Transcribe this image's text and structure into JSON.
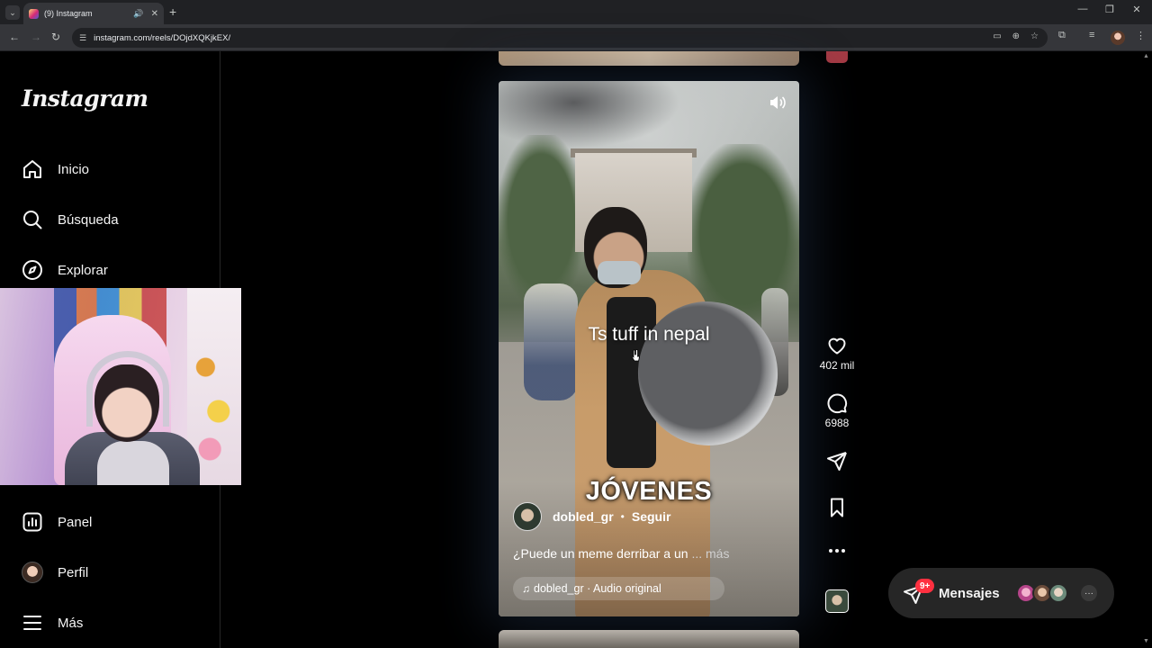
{
  "browser": {
    "tab_title": "(9) Instagram",
    "url": "instagram.com/reels/DOjdXQKjkEX/",
    "new_tab": "+",
    "win_min": "—",
    "win_restore": "❐",
    "win_close": "✕"
  },
  "sidebar": {
    "logo": "Instagram",
    "items": [
      {
        "label": "Inicio",
        "icon": "home-icon"
      },
      {
        "label": "Búsqueda",
        "icon": "search-icon"
      },
      {
        "label": "Explorar",
        "icon": "compass-icon"
      },
      {
        "label": "Panel",
        "icon": "dashboard-icon"
      },
      {
        "label": "Perfil",
        "icon": "avatar"
      },
      {
        "label": "Más",
        "icon": "menu-icon"
      }
    ]
  },
  "reel": {
    "overlay_text": "Ts tuff in nepal",
    "caption_big": "JÓVENES",
    "author": "dobled_gr",
    "separator": "•",
    "follow": "Seguir",
    "description": "¿Puede un meme derribar a un",
    "more": "... más",
    "audio": "dobled_gr · Audio original"
  },
  "actions": {
    "likes": "402 mil",
    "comments": "6988"
  },
  "messages": {
    "label": "Mensajes",
    "badge": "9+",
    "more": "···"
  },
  "colors": {
    "background": "#000000",
    "badge": "#ff3040",
    "chrome_dark": "#202124",
    "chrome_toolbar": "#35363a"
  }
}
